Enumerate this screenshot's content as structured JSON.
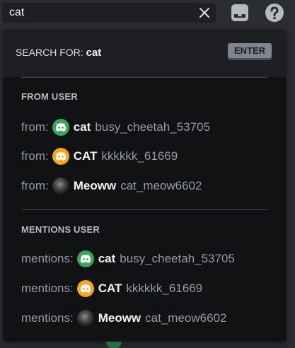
{
  "search": {
    "value": "cat"
  },
  "colors": {
    "green_avatar": "#3ba55d",
    "orange_avatar": "#faa61a",
    "popout_bg": "#111214"
  },
  "popout": {
    "search_for_label": "SEARCH FOR:",
    "search_for_term": "cat",
    "enter_label": "ENTER",
    "from_user": {
      "title": "FROM USER",
      "items": [
        {
          "prefix": "from:",
          "name": "cat",
          "tag": "busy_cheetah_53705",
          "avatar": "green-discord-icon"
        },
        {
          "prefix": "from:",
          "name": "CAT",
          "tag": "kkkkkk_61669",
          "avatar": "orange-discord-icon"
        },
        {
          "prefix": "from:",
          "name": "Meoww",
          "tag": "cat_meow6602",
          "avatar": "photo-avatar"
        }
      ]
    },
    "mentions_user": {
      "title": "MENTIONS USER",
      "items": [
        {
          "prefix": "mentions:",
          "name": "cat",
          "tag": "busy_cheetah_53705",
          "avatar": "green-discord-icon"
        },
        {
          "prefix": "mentions:",
          "name": "CAT",
          "tag": "kkkkkk_61669",
          "avatar": "orange-discord-icon"
        },
        {
          "prefix": "mentions:",
          "name": "Meoww",
          "tag": "cat_meow6602",
          "avatar": "photo-avatar"
        }
      ]
    }
  }
}
